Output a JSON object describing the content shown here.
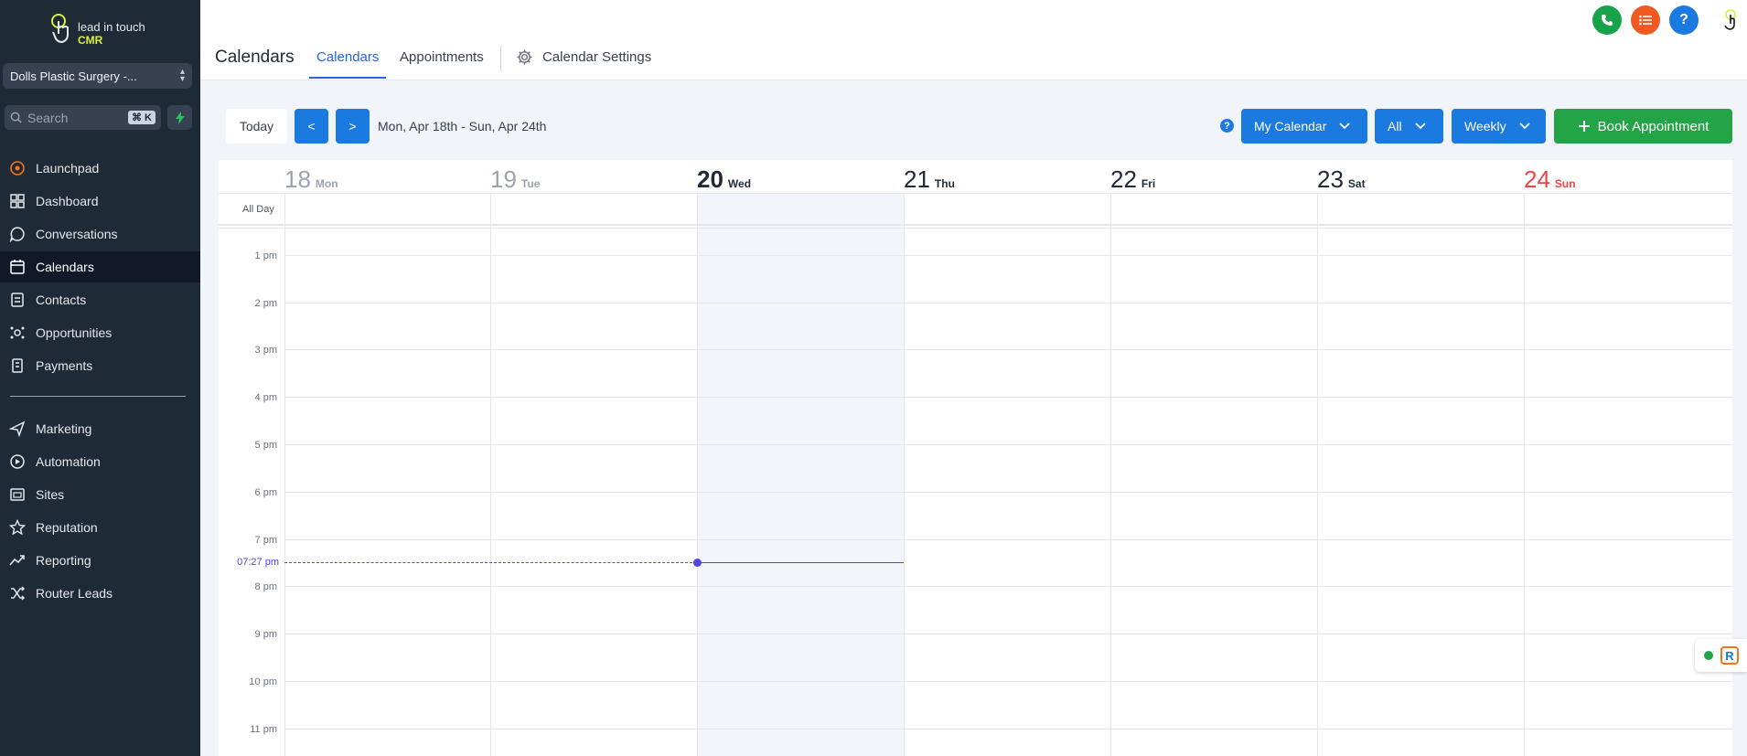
{
  "brand": {
    "line1": "lead in touch",
    "line2": "CMR",
    "accent": "#d9f03a"
  },
  "location": {
    "name": "Dolls Plastic Surgery -..."
  },
  "search": {
    "placeholder": "Search",
    "shortcut": "⌘ K"
  },
  "sidebar": {
    "items": [
      {
        "label": "Launchpad",
        "icon": "launchpad-icon"
      },
      {
        "label": "Dashboard",
        "icon": "dashboard-icon"
      },
      {
        "label": "Conversations",
        "icon": "chat-icon"
      },
      {
        "label": "Calendars",
        "icon": "calendar-icon",
        "active": true
      },
      {
        "label": "Contacts",
        "icon": "contacts-icon"
      },
      {
        "label": "Opportunities",
        "icon": "opportunities-icon"
      },
      {
        "label": "Payments",
        "icon": "payments-icon"
      },
      {
        "label": "Marketing",
        "icon": "send-icon"
      },
      {
        "label": "Automation",
        "icon": "automation-icon"
      },
      {
        "label": "Sites",
        "icon": "sites-icon"
      },
      {
        "label": "Reputation",
        "icon": "star-icon"
      },
      {
        "label": "Reporting",
        "icon": "trend-icon"
      },
      {
        "label": "Router Leads",
        "icon": "shuffle-icon"
      }
    ]
  },
  "header": {
    "title": "Calendars",
    "tabs": {
      "calendars": "Calendars",
      "appointments": "Appointments",
      "settings": "Calendar Settings"
    },
    "help": "?"
  },
  "toolbar": {
    "today": "Today",
    "prev": "<",
    "next": ">",
    "range": "Mon, Apr 18th - Sun, Apr 24th",
    "help": "?",
    "calendar_select": "My Calendar",
    "filter_select": "All",
    "view_select": "Weekly",
    "book": "Book Appointment"
  },
  "calendar": {
    "days": [
      {
        "num": "18",
        "name": "Mon"
      },
      {
        "num": "19",
        "name": "Tue"
      },
      {
        "num": "20",
        "name": "Wed"
      },
      {
        "num": "21",
        "name": "Thu"
      },
      {
        "num": "22",
        "name": "Fri"
      },
      {
        "num": "23",
        "name": "Sat"
      },
      {
        "num": "24",
        "name": "Sun"
      }
    ],
    "all_day": "All Day",
    "hours": [
      "1 pm",
      "2 pm",
      "3 pm",
      "4 pm",
      "5 pm",
      "6 pm",
      "7 pm",
      "8 pm",
      "9 pm",
      "10 pm",
      "11 pm"
    ],
    "now": "07:27 pm"
  },
  "colors": {
    "primary": "#1a7ae0",
    "success": "#22a447",
    "sidebar": "#1f2a37",
    "now": "#4f46e5",
    "sunday": "#ef4444"
  }
}
